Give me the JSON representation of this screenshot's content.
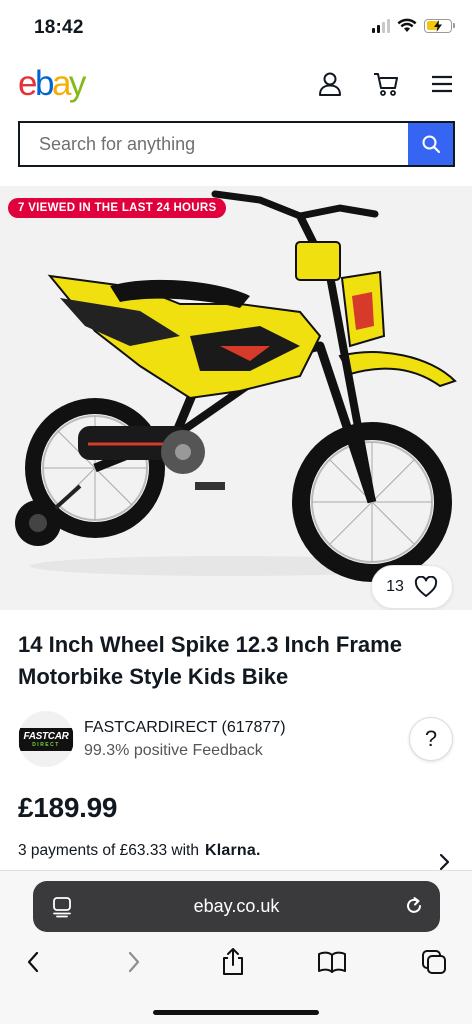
{
  "status_bar": {
    "time": "18:42"
  },
  "header": {
    "logo": {
      "e": "e",
      "b": "b",
      "a": "a",
      "y": "y"
    },
    "icons": [
      "user-icon",
      "cart-icon",
      "menu-icon"
    ]
  },
  "search": {
    "placeholder": "Search for anything",
    "value": ""
  },
  "hero": {
    "badge": "7 VIEWED IN THE LAST 24 HOURS",
    "watch_count": "13"
  },
  "product": {
    "title": "14 Inch Wheel Spike 12.3 Inch Frame Motorbike Style Kids Bike"
  },
  "seller": {
    "logo_text": "FASTCAR",
    "logo_subtext": "DIRECT",
    "name": "FASTCARDIRECT (617877)",
    "feedback": "99.3% positive Feedback",
    "help_label": "?"
  },
  "price": {
    "amount": "£189.99",
    "payments_text": "3 payments of £63.33 with",
    "provider": "Klarna."
  },
  "browser": {
    "url": "ebay.co.uk"
  },
  "colors": {
    "ebay_red": "#e53238",
    "ebay_blue": "#0064d2",
    "ebay_yellow": "#f5af02",
    "ebay_green": "#86b817",
    "search_button": "#3665f3",
    "badge_red": "#e0003c"
  }
}
